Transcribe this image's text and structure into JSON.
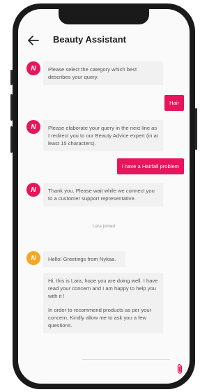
{
  "header": {
    "title": "Beauty Assistant",
    "back_icon": "arrow-left-icon"
  },
  "colors": {
    "brand": "#e8155d",
    "agent_avatar": "#f5a623",
    "bot_bubble": "#f1f1f1"
  },
  "messages": {
    "bot_1": "Please select the category which best describes your query.",
    "user_1": "Hair",
    "bot_2": "Please elaborate your query in the next line as I redirect you to our Beauty Advice expert (in at least 15 characters).",
    "user_2": "I have a Hairfall problem",
    "bot_3": "Thank you. Please wait while we connect you to a customer support representative.",
    "status_joined": "Lara joined",
    "agent_1": "Hello! Greetings from Nykaa.",
    "agent_2_p1": "Hi, this is Lara, hope you are doing well. I have read your concern and I am happy to help you with it !",
    "agent_2_p2": "In order to recommend products as per your concern, Kindly allow me to ask you a few questions."
  },
  "avatars": {
    "bot_letter": "N",
    "agent_letter": "N"
  },
  "input": {
    "placeholder": "",
    "attach_icon": "paperclip-icon"
  }
}
